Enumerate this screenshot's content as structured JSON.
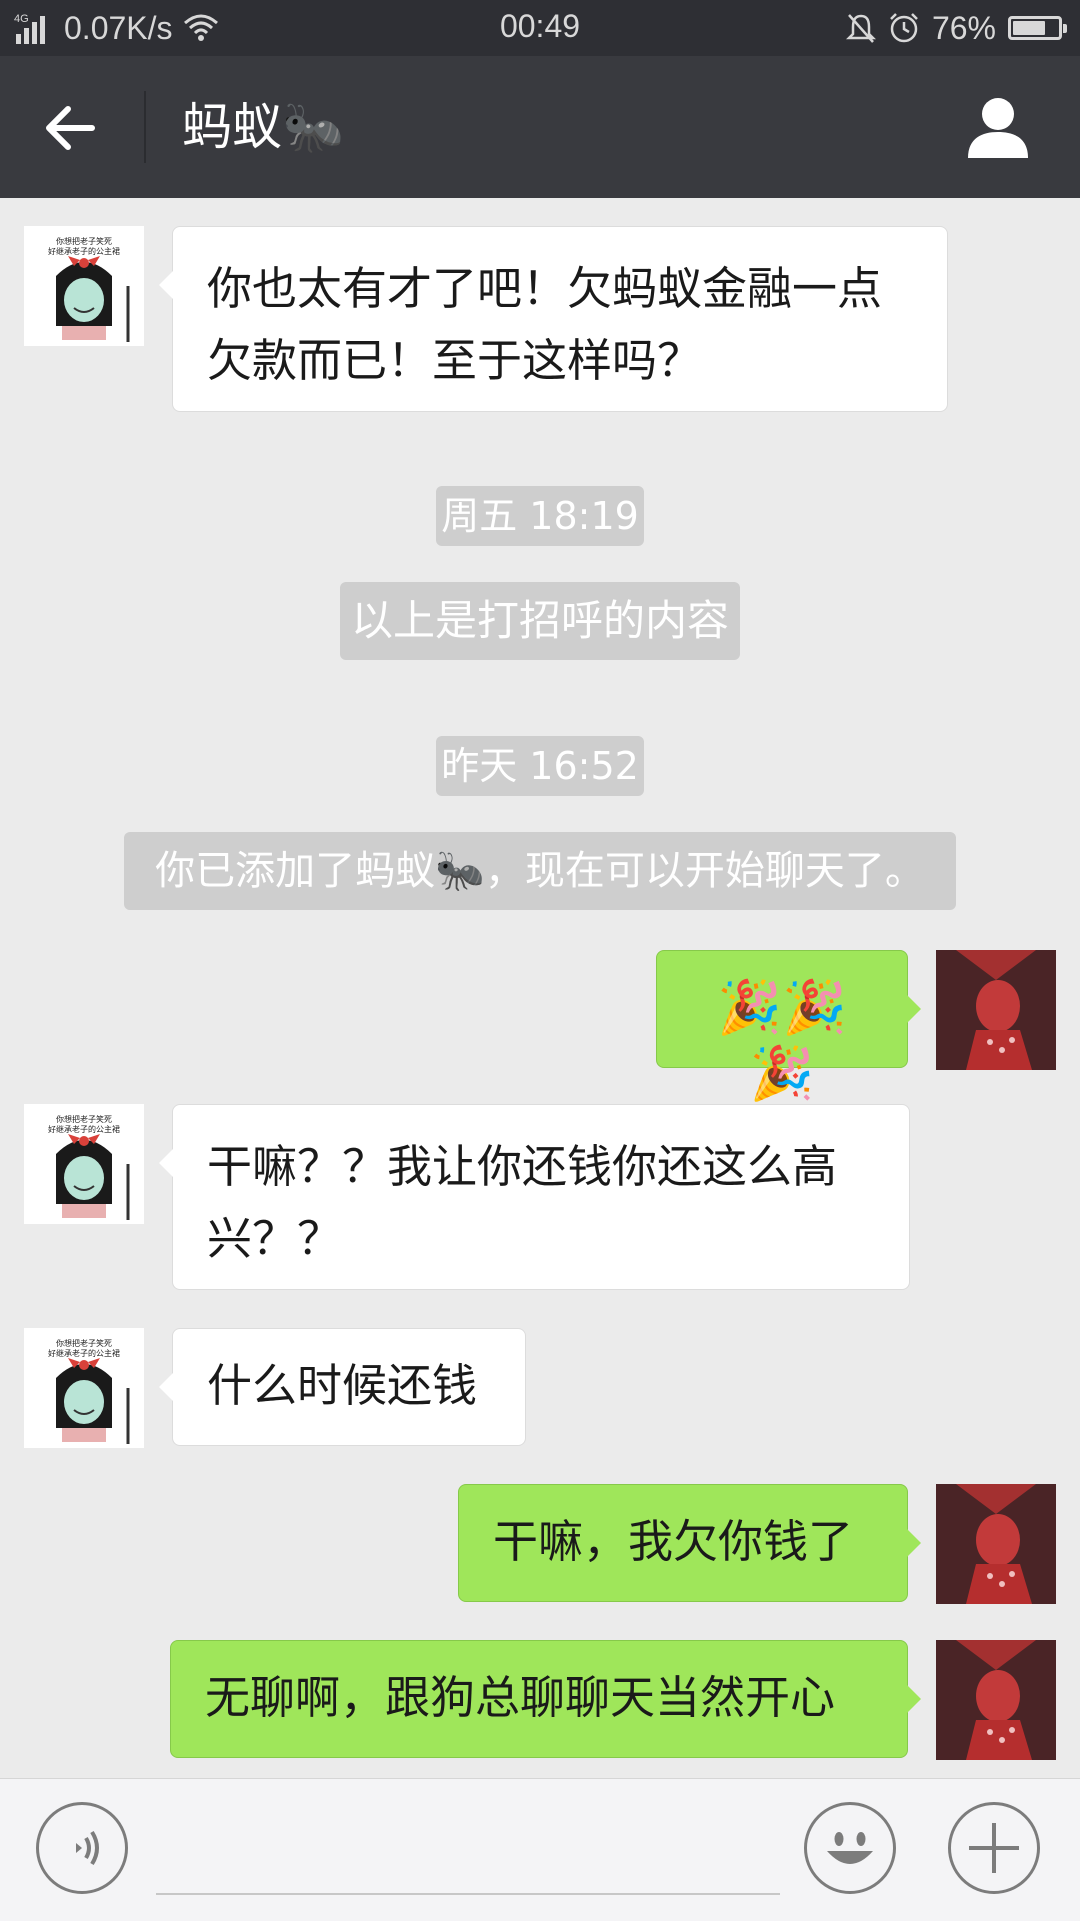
{
  "status_bar": {
    "network_type": "4G",
    "speed": "0.07K/s",
    "time": "00:49",
    "battery_text": "76%",
    "battery_level": 0.76,
    "icons": [
      "signal-icon",
      "wifi-icon",
      "mute-bell-icon",
      "alarm-icon",
      "battery-icon"
    ]
  },
  "header": {
    "title": "蚂蚁🐜",
    "back_icon": "back-arrow-icon",
    "contact_icon": "person-icon"
  },
  "messages": [
    {
      "side": "left",
      "text_line1": "你也太有才了吧！欠蚂蚁金融一点",
      "text_line2": "欠款而已！至于这样吗？"
    },
    {
      "type": "time",
      "text": "周五 18:19"
    },
    {
      "type": "system",
      "text": "以上是打招呼的内容"
    },
    {
      "type": "time",
      "text": "昨天 16:52"
    },
    {
      "type": "system",
      "text": "你已添加了蚂蚁🐜，现在可以开始聊天了。"
    },
    {
      "side": "right",
      "text": "🎉🎉🎉"
    },
    {
      "side": "left",
      "text_line1": "干嘛？？我让你还钱你还这么高",
      "text_line2": "兴？？"
    },
    {
      "side": "left",
      "text": "什么时候还钱"
    },
    {
      "side": "right",
      "text": "干嘛，我欠你钱了"
    },
    {
      "side": "right",
      "text": "无聊啊，跟狗总聊聊天当然开心"
    }
  ],
  "avatar_left_caption_line1": "你想把老子笑死",
  "avatar_left_caption_line2": "好继承老子的公主裙",
  "input_bar": {
    "voice_icon": "voice-icon",
    "emoji_icon": "emoji-icon",
    "more_icon": "plus-icon"
  },
  "colors": {
    "title_bar": "#393a3f",
    "status_bar": "#2e2f34",
    "chat_bg": "#ebebeb",
    "outgoing_bubble": "#9fe65a",
    "incoming_bubble": "#ffffff",
    "system_bubble": "#cecece"
  }
}
